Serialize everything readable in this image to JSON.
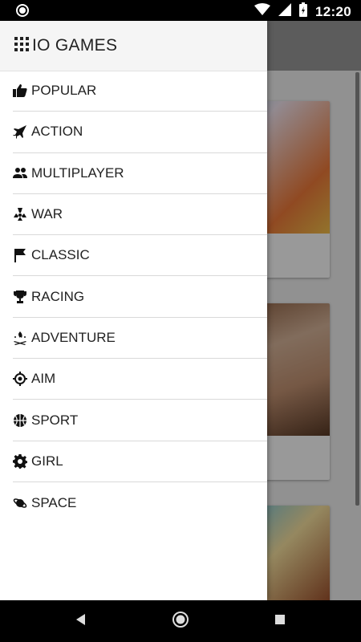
{
  "status_bar": {
    "time": "12:20"
  },
  "drawer": {
    "title": "IO GAMES",
    "items": [
      {
        "label": "POPULAR",
        "icon": "thumbs-up-icon"
      },
      {
        "label": "ACTION",
        "icon": "jet-icon"
      },
      {
        "label": "MULTIPLAYER",
        "icon": "people-icon"
      },
      {
        "label": "WAR",
        "icon": "radiation-icon"
      },
      {
        "label": "CLASSIC",
        "icon": "flag-icon"
      },
      {
        "label": "RACING",
        "icon": "trophy-icon"
      },
      {
        "label": "ADVENTURE",
        "icon": "campfire-icon"
      },
      {
        "label": "AIM",
        "icon": "crosshair-icon"
      },
      {
        "label": "SPORT",
        "icon": "basketball-icon"
      },
      {
        "label": "GIRL",
        "icon": "gear-icon"
      },
      {
        "label": "SPACE",
        "icon": "planet-icon"
      }
    ]
  }
}
